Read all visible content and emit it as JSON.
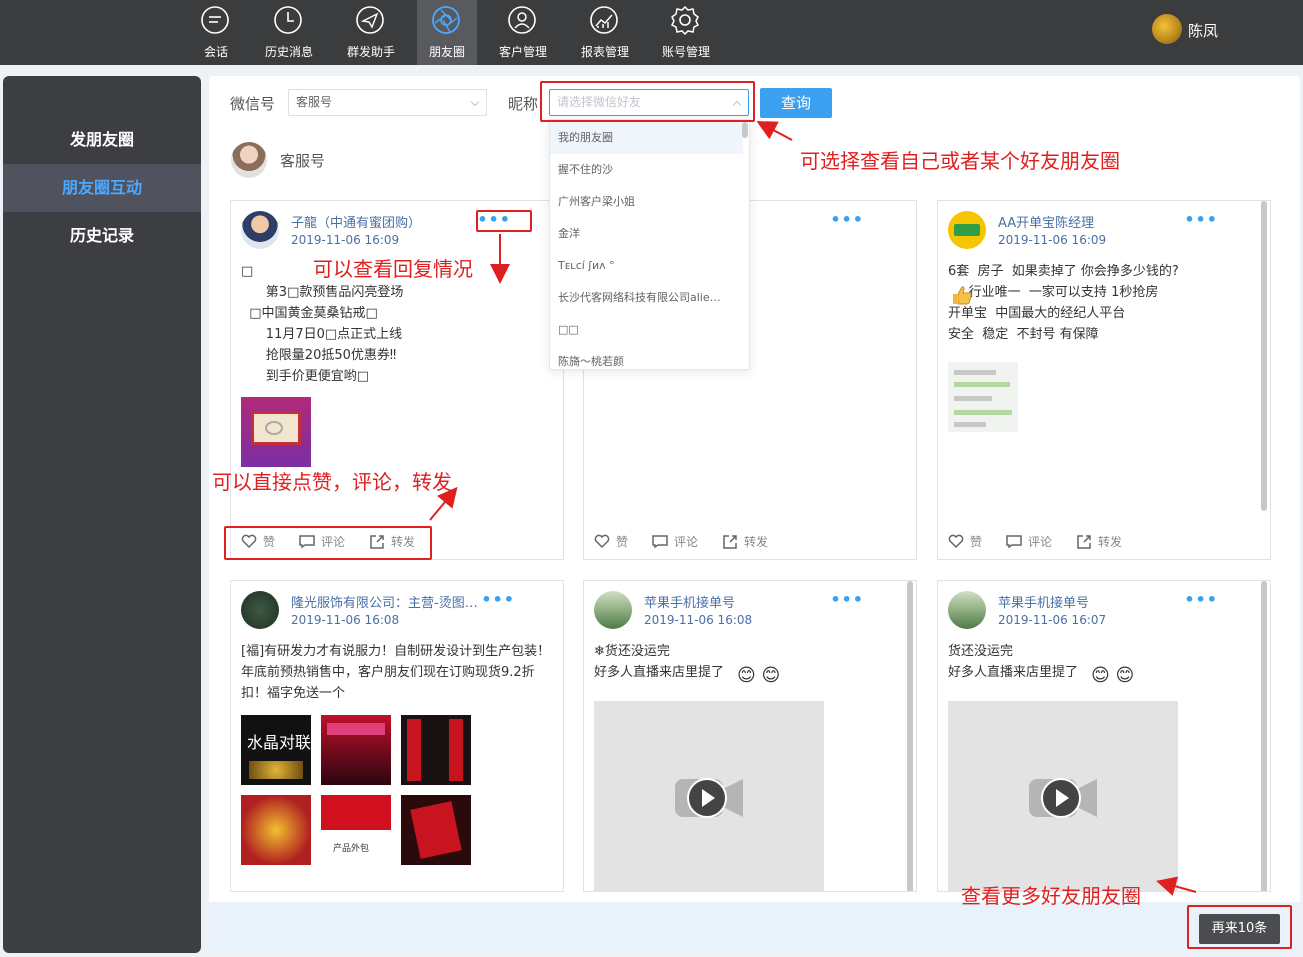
{
  "nav": {
    "items": [
      {
        "label": "会话",
        "icon": "chat-icon"
      },
      {
        "label": "历史消息",
        "icon": "clock-icon"
      },
      {
        "label": "群发助手",
        "icon": "send-icon"
      },
      {
        "label": "朋友圈",
        "icon": "aperture-icon"
      },
      {
        "label": "客户管理",
        "icon": "user-icon"
      },
      {
        "label": "报表管理",
        "icon": "chart-icon"
      },
      {
        "label": "账号管理",
        "icon": "gear-icon"
      }
    ],
    "active": "朋友圈",
    "user": "陈凤"
  },
  "sidebar": {
    "items": [
      "发朋友圈",
      "朋友圈互动",
      "历史记录"
    ],
    "active": "朋友圈互动"
  },
  "filter": {
    "wechat_label": "微信号",
    "wechat_value": "客服号",
    "nickname_label": "昵称",
    "nickname_placeholder": "请选择微信好友",
    "query_button": "查询"
  },
  "account": {
    "name": "客服号"
  },
  "dropdown": {
    "options": [
      "我的朋友圈",
      "握不住的沙",
      "广州客户梁小姐",
      "金洋",
      "Tᴇʟᴄí ʃиʌ °",
      "长沙代客网络科技有限公司alie…",
      "□□",
      "陈旖～桃若颜"
    ],
    "highlighted": "我的朋友圈"
  },
  "actions": {
    "like": "赞",
    "comment": "评论",
    "share": "转发"
  },
  "more_glyph": "•••",
  "posts": [
    {
      "author": "子龍（中通有蜜团购）",
      "time": "2019-11-06 16:09",
      "text": "□\n      第3□款预售品闪亮登场\n  □中国黄金莫桑钻戒□\n      11月7日0□点正式上线\n      抢限量20抵50优惠券‼\n      到手价更便宜哟□"
    },
    {
      "author": "",
      "time": "",
      "text": ""
    },
    {
      "author": "AA开单宝陈经理",
      "time": "2019-11-06 16:09",
      "text": "6套  房子  如果卖掉了 你会挣多少钱的?\n     行业唯一  一家可以支持 1秒抢房\n开单宝  中国最大的经纪人平台\n安全  稳定  不封号 有保障"
    },
    {
      "author": "隆光服饰有限公司：主营-烫图…",
      "time": "2019-11-06 16:08",
      "text": "[福]有研发力才有说服力！自制研发设计到生产包装！年底前预热销售中，客户朋友们现在订购现货9.2折扣！福字免送一个"
    },
    {
      "author": "苹果手机接单号",
      "time": "2019-11-06 16:08",
      "text": "❄货还没运完\n好多人直播来店里提了"
    },
    {
      "author": "苹果手机接单号",
      "time": "2019-11-06 16:07",
      "text": "货还没运完\n好多人直播来店里提了"
    }
  ],
  "post_image_texts": {
    "couplet": "水晶对联",
    "brand": "产品外包"
  },
  "annotations": {
    "reply": "可以查看回复情况",
    "interact": "可以直接点赞，评论，转发",
    "select": "可选择查看自己或者某个好友朋友圈",
    "more": "查看更多好友朋友圈"
  },
  "footer": {
    "more_button": "再来10条"
  },
  "colors": {
    "nav_bg": "#3b3c3e",
    "accent": "#3ba0f0",
    "annotation": "#e02020",
    "sidebar_active": "#4aa8ff"
  }
}
